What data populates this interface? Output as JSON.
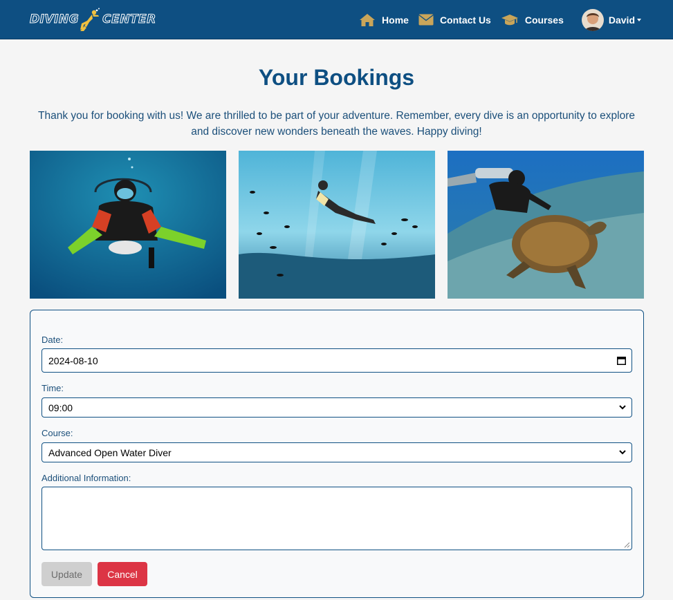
{
  "navbar": {
    "logo_left": "DIVING",
    "logo_right": "CENTER",
    "links": [
      {
        "label": "Home",
        "icon": "home-icon"
      },
      {
        "label": "Contact Us",
        "icon": "envelope-icon"
      },
      {
        "label": "Courses",
        "icon": "graduation-cap-icon"
      }
    ],
    "user_name": "David"
  },
  "page": {
    "title": "Your Bookings",
    "intro": "Thank you for booking with us! We are thrilled to be part of your adventure. Remember, every dive is an opportunity to explore and discover new wonders beneath the waves. Happy diving!"
  },
  "form": {
    "date_label": "Date:",
    "date_value": "2024-08-10",
    "time_label": "Time:",
    "time_value": "09:00",
    "course_label": "Course:",
    "course_value": "Advanced Open Water Diver",
    "info_label": "Additional Information:",
    "info_value": "",
    "update_label": "Update",
    "cancel_label": "Cancel"
  },
  "colors": {
    "navbar": "#0e4f82",
    "icon_gold": "#c9a55a",
    "cancel": "#dc3545",
    "update_disabled": "#cfcfcf"
  }
}
